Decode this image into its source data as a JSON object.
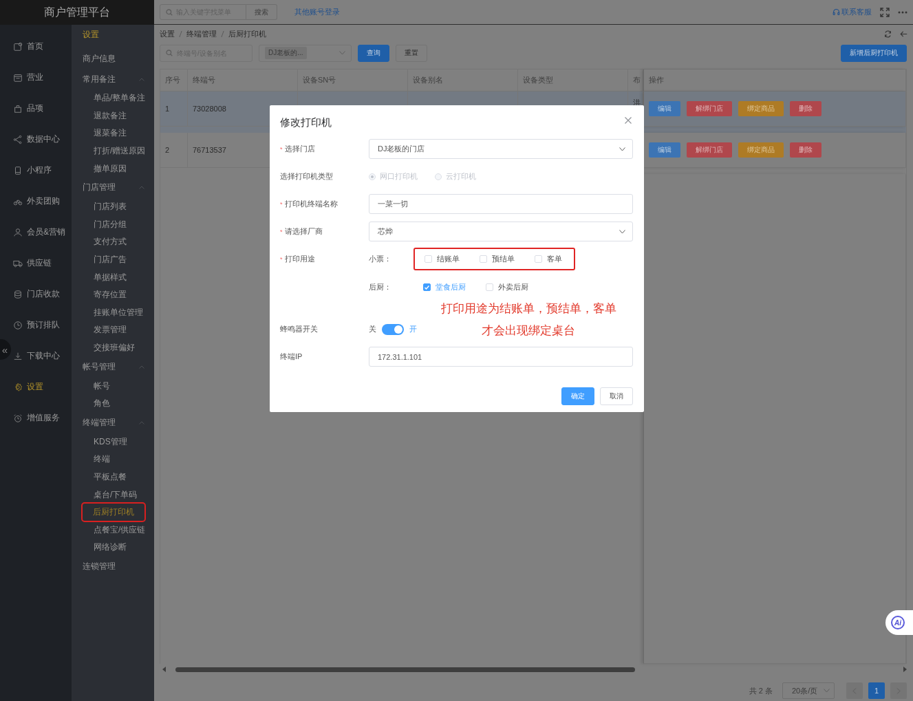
{
  "brand": "商户管理平台",
  "nav": [
    {
      "label": "首页",
      "selected": false
    },
    {
      "label": "营业",
      "selected": false
    },
    {
      "label": "品项",
      "selected": false
    },
    {
      "label": "数据中心",
      "selected": false
    },
    {
      "label": "小程序",
      "selected": false
    },
    {
      "label": "外卖团购",
      "selected": false
    },
    {
      "label": "会员&营销",
      "selected": false
    },
    {
      "label": "供应链",
      "selected": false
    },
    {
      "label": "门店收款",
      "selected": false
    },
    {
      "label": "预订排队",
      "selected": false
    },
    {
      "label": "下载中心",
      "selected": false
    },
    {
      "label": "设置",
      "selected": true
    },
    {
      "label": "增值服务",
      "selected": false
    }
  ],
  "collapse_button": "«",
  "subnav": {
    "title": "设置",
    "items": [
      {
        "label": "商户信息",
        "kind": "link",
        "selected": false
      },
      {
        "label": "常用备注",
        "kind": "group",
        "expanded": true,
        "children": [
          {
            "label": "单品/整单备注",
            "selected": false,
            "highlighted": false
          },
          {
            "label": "退款备注",
            "selected": false,
            "highlighted": false
          },
          {
            "label": "退菜备注",
            "selected": false,
            "highlighted": false
          },
          {
            "label": "打折/赠送原因",
            "selected": false,
            "highlighted": false
          },
          {
            "label": "撤单原因",
            "selected": false,
            "highlighted": false
          }
        ]
      },
      {
        "label": "门店管理",
        "kind": "group",
        "expanded": true,
        "children": [
          {
            "label": "门店列表",
            "selected": false,
            "highlighted": false
          },
          {
            "label": "门店分组",
            "selected": false,
            "highlighted": false
          },
          {
            "label": "支付方式",
            "selected": false,
            "highlighted": false
          },
          {
            "label": "门店广告",
            "selected": false,
            "highlighted": false
          },
          {
            "label": "单据样式",
            "selected": false,
            "highlighted": false
          },
          {
            "label": "寄存位置",
            "selected": false,
            "highlighted": false
          },
          {
            "label": "挂账单位管理",
            "selected": false,
            "highlighted": false
          },
          {
            "label": "发票管理",
            "selected": false,
            "highlighted": false
          },
          {
            "label": "交接班偏好",
            "selected": false,
            "highlighted": false
          }
        ]
      },
      {
        "label": "帐号管理",
        "kind": "group",
        "expanded": true,
        "children": [
          {
            "label": "帐号",
            "selected": false,
            "highlighted": false
          },
          {
            "label": "角色",
            "selected": false,
            "highlighted": false
          }
        ]
      },
      {
        "label": "终端管理",
        "kind": "group",
        "expanded": true,
        "children": [
          {
            "label": "KDS管理",
            "selected": false,
            "highlighted": false
          },
          {
            "label": "终端",
            "selected": false,
            "highlighted": false
          },
          {
            "label": "平板点餐",
            "selected": false,
            "highlighted": false
          },
          {
            "label": "桌台/下单码",
            "selected": false,
            "highlighted": false
          },
          {
            "label": "后厨打印机",
            "selected": true,
            "highlighted": true
          },
          {
            "label": "点餐宝/供应链",
            "selected": false,
            "highlighted": false
          },
          {
            "label": "网络诊断",
            "selected": false,
            "highlighted": false
          }
        ]
      },
      {
        "label": "连锁管理",
        "kind": "link",
        "selected": false
      }
    ]
  },
  "topbar": {
    "search_placeholder": "输入关键字找菜单",
    "search_button": "搜索",
    "link": "其他账号登录",
    "support": "联系客服"
  },
  "breadcrumb": [
    "设置",
    "终端管理",
    "后厨打印机"
  ],
  "filters": {
    "search_placeholder": "终端号/设备别名",
    "store_tag": "DJ老板的...",
    "query": "查询",
    "reset": "重置",
    "add": "新增后厨打印机"
  },
  "table": {
    "columns": [
      "序号",
      "终端号",
      "设备SN号",
      "设备别名",
      "设备类型",
      "布",
      "操作"
    ],
    "rows": [
      {
        "highlighted": true,
        "cells": [
          "1",
          "73028008",
          "",
          "",
          "",
          "洪"
        ],
        "actions": [
          {
            "label": "编辑",
            "kind": "primary"
          },
          {
            "label": "解绑门店",
            "kind": "danger"
          },
          {
            "label": "绑定商品",
            "kind": "warning"
          },
          {
            "label": "删除",
            "kind": "danger"
          }
        ]
      },
      {
        "highlighted": false,
        "cells": [
          "2",
          "76713537",
          "",
          "",
          "",
          ""
        ],
        "actions": [
          {
            "label": "编辑",
            "kind": "primary"
          },
          {
            "label": "解绑门店",
            "kind": "danger"
          },
          {
            "label": "绑定商品",
            "kind": "warning"
          },
          {
            "label": "删除",
            "kind": "danger"
          }
        ]
      }
    ]
  },
  "pagination": {
    "total": "共 2 条",
    "page_size": "20条/页",
    "pages": [
      {
        "label": "1",
        "selected": true
      }
    ]
  },
  "ai_button": "Ai",
  "dialog": {
    "title": "修改打印机",
    "fields": [
      {
        "kind": "select",
        "label": "选择门店",
        "required_mark": "*",
        "value": "DJ老板的门店"
      },
      {
        "kind": "radio",
        "label": "选择打印机类型",
        "options": [
          {
            "label": "网口打印机",
            "selected": true,
            "disabled": true
          },
          {
            "label": "云打印机",
            "selected": false,
            "disabled": true
          }
        ]
      },
      {
        "kind": "input",
        "label": "打印机终端名称",
        "required_mark": "*",
        "value": "一菜一切"
      },
      {
        "kind": "select",
        "label": "请选择厂商",
        "required_mark": "*",
        "value": "芯烨"
      },
      {
        "kind": "checkgroups",
        "label": "打印用途",
        "required_mark": "*",
        "groups": [
          {
            "label": "小票：",
            "highlighted": true,
            "options": [
              {
                "label": "结账单",
                "checked": false
              },
              {
                "label": "预结单",
                "checked": false
              },
              {
                "label": "客单",
                "checked": false
              }
            ]
          },
          {
            "label": "后厨：",
            "highlighted": false,
            "options": [
              {
                "label": "堂食后厨",
                "checked": true
              },
              {
                "label": "外卖后厨",
                "checked": false
              }
            ]
          }
        ]
      },
      {
        "kind": "switch",
        "label": "蜂鸣器开关",
        "off_label": "关",
        "on_label": "开",
        "on": true
      },
      {
        "kind": "input",
        "label": "终端IP",
        "value": "172.31.1.101"
      }
    ],
    "buttons": [
      {
        "label": "确定",
        "kind": "primary"
      },
      {
        "label": "取消",
        "kind": "default"
      }
    ]
  },
  "annotation": {
    "lines": [
      "打印用途为结账单，预结单，客单",
      "才会出现绑定桌台"
    ]
  }
}
